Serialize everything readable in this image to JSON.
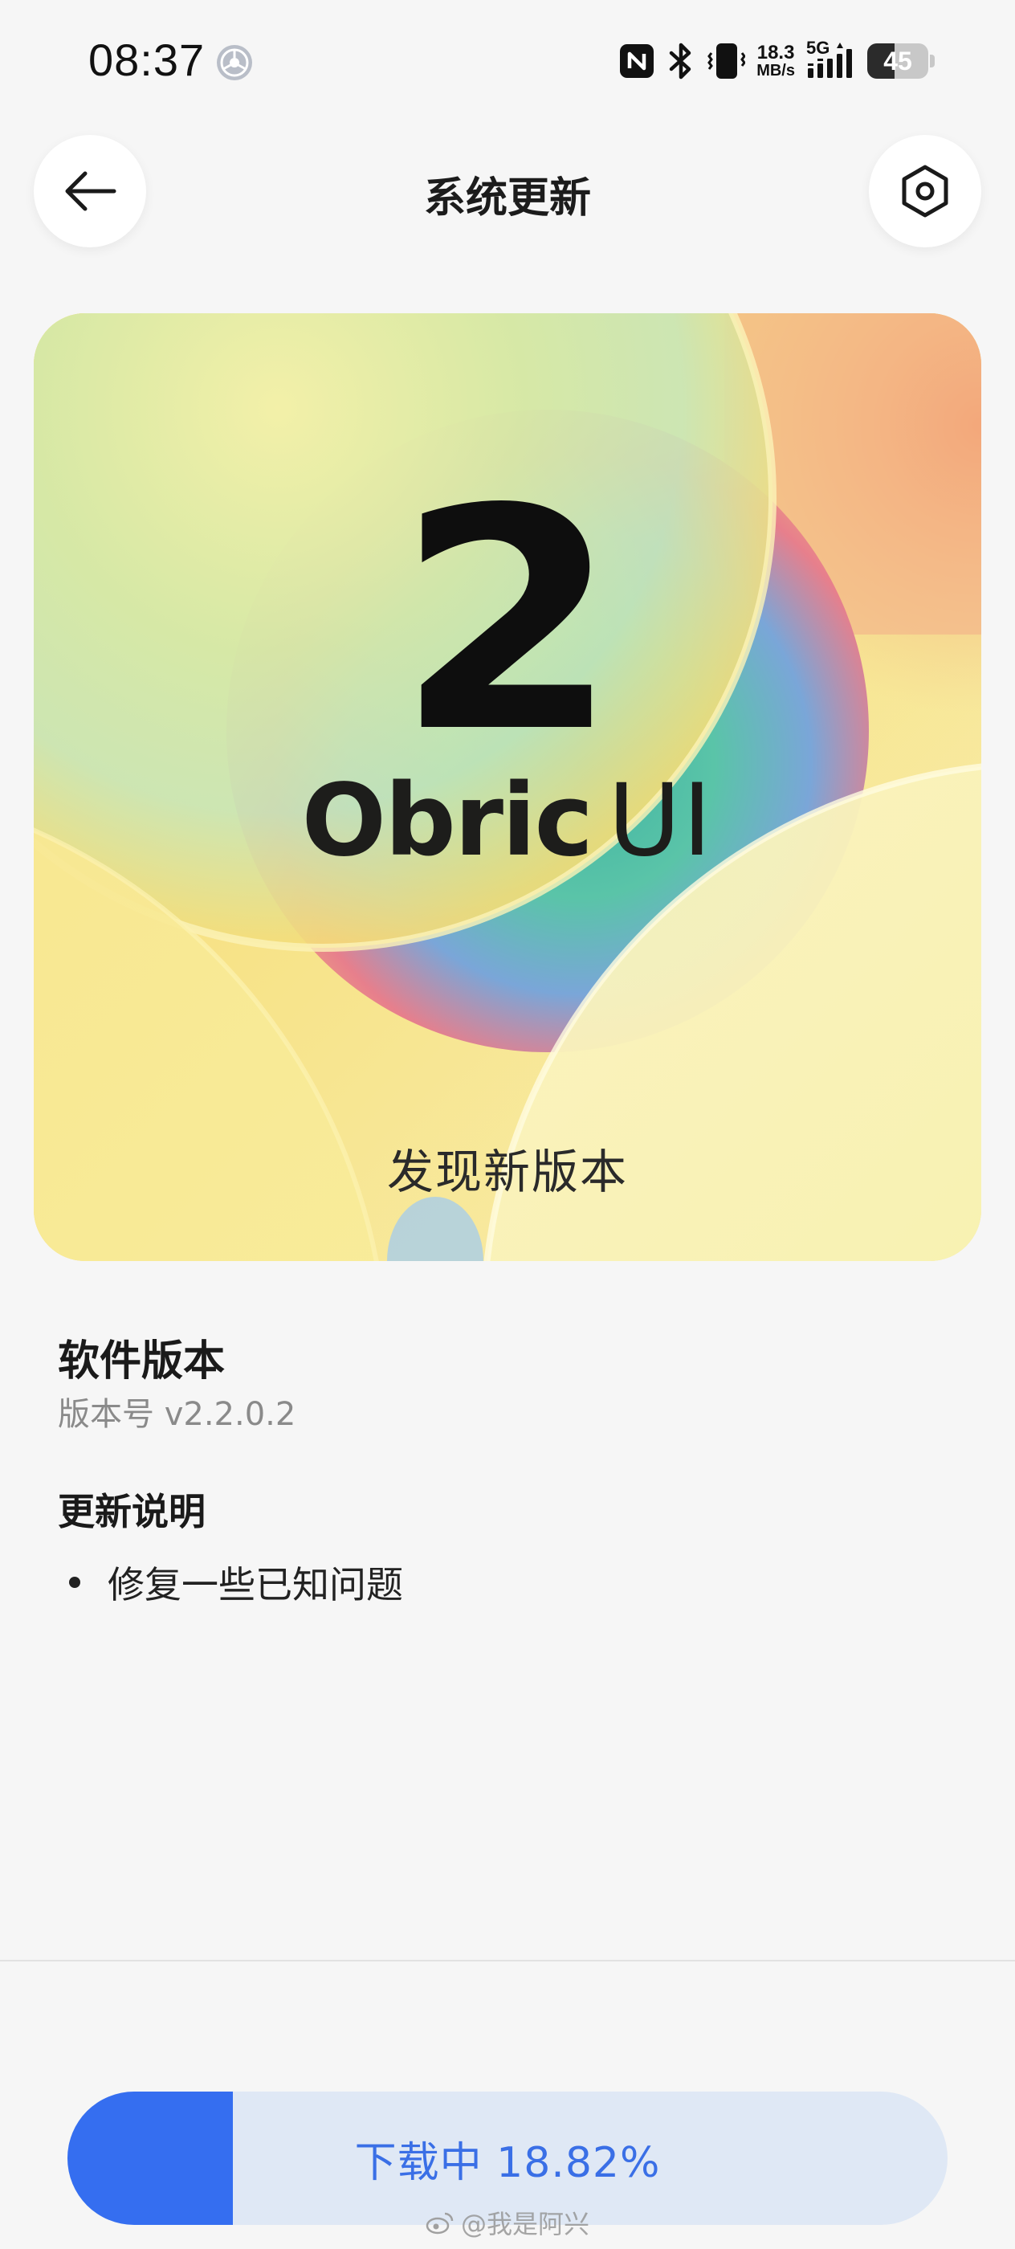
{
  "status_bar": {
    "time": "08:37",
    "net_speed_value": "18.3",
    "net_speed_unit": "MB/s",
    "network_type": "5G",
    "battery_level": "45",
    "battery_fraction": 0.45
  },
  "header": {
    "title": "系统更新"
  },
  "banner": {
    "version_number": "2",
    "brand_bold": "Obric",
    "brand_light": "UI",
    "status_text": "发现新版本"
  },
  "software": {
    "title": "软件版本",
    "version_label": "版本号 v2.2.0.2"
  },
  "release_notes": {
    "title": "更新说明",
    "items": [
      "修复一些已知问题"
    ]
  },
  "download": {
    "label": "下载中 18.82%",
    "progress_percent": 18.82,
    "fill_color": "#356ef0",
    "track_color": "#dfe8f5"
  },
  "watermark": {
    "text": "@我是阿兴"
  },
  "icons": {
    "back": "arrow-left-icon",
    "settings": "hexagon-settings-icon",
    "nfc": "nfc-icon",
    "bluetooth": "bluetooth-icon",
    "vibrate": "vibrate-icon",
    "signal": "signal-icon"
  }
}
